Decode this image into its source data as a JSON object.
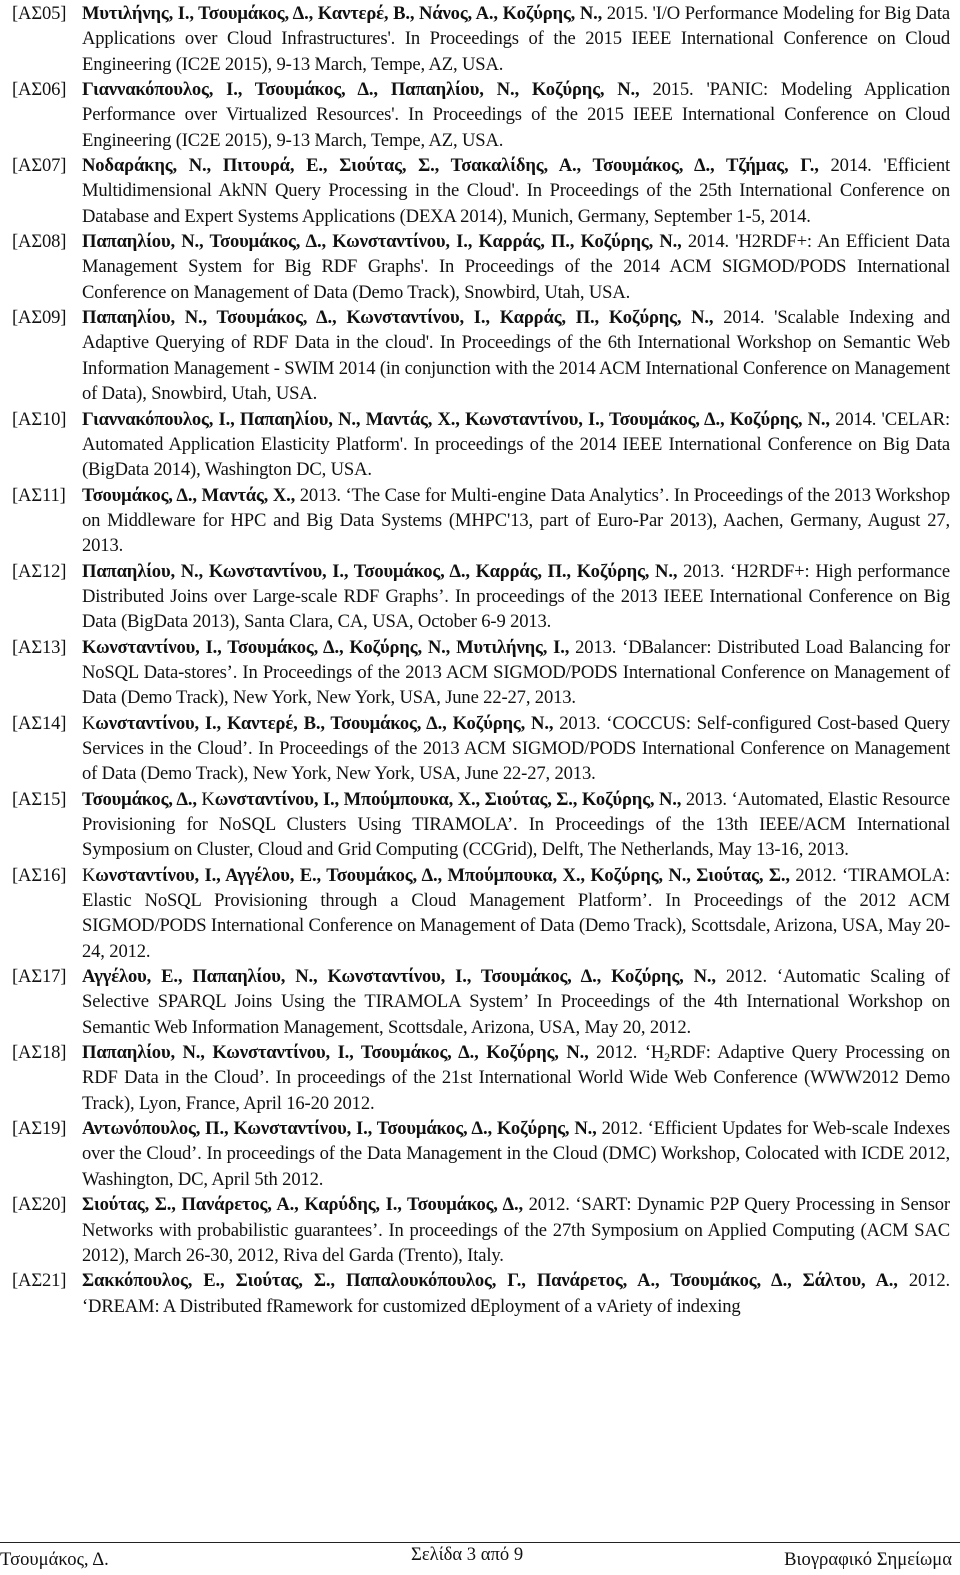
{
  "document": {
    "references": [
      {
        "id": "[ΑΣ05]",
        "authors": [
          {
            "text": "Μυτιλήνης, Ι., "
          },
          {
            "text": "Τσουμάκος, Δ., "
          },
          {
            "text": "Καντερέ, Β., "
          },
          {
            "text": "Νάνος, Α., "
          },
          {
            "text": "Κοζύρης, Ν.,"
          }
        ],
        "year": " 2015.",
        "body": " 'I/O Performance Modeling for Big Data Applications over Cloud Infrastructures'. In Proceedings of the 2015 IEEE International Conference on Cloud Engineering (IC2E 2015), 9-13 March, Tempe, AZ, USA."
      },
      {
        "id": "[ΑΣ06]",
        "authors": [
          {
            "text": "Γιαννακόπουλος, Ι., "
          },
          {
            "text": "Τσουμάκος, Δ., "
          },
          {
            "text": "Παπαηλίου, Ν., "
          },
          {
            "text": "Κοζύρης, Ν.,"
          }
        ],
        "year": " 2015.",
        "body": " 'PANIC: Modeling Application Performance over Virtualized Resources'. In Proceedings of the 2015 IEEE International Conference on Cloud Engineering (IC2E 2015), 9-13 March, Tempe, AZ, USA."
      },
      {
        "id": "[ΑΣ07]",
        "authors": [
          {
            "text": "Νοδαράκης, Ν., "
          },
          {
            "text": "Πιτουρά, Ε., "
          },
          {
            "text": "Σιούτας, Σ., "
          },
          {
            "text": "Τσακαλίδης, Α., "
          },
          {
            "text": "Τσουμάκος, Δ., "
          },
          {
            "text": "Τζήμας, Γ.,"
          }
        ],
        "year": " 2014.",
        "body": " 'Efficient Multidimensional AkNN Query Processing in the Cloud'. In Proceedings of the 25th International Conference on Database and Expert Systems Applications (DEXA 2014), Munich, Germany, September 1-5, 2014."
      },
      {
        "id": "[ΑΣ08]",
        "authors": [
          {
            "text": "Παπαηλίου, Ν., "
          },
          {
            "text": "Τσουμάκος, Δ., "
          },
          {
            "text": "Κωνσταντίνου, Ι., "
          },
          {
            "text": "Καρράς, Π., "
          },
          {
            "text": "Κοζύρης, Ν.,"
          }
        ],
        "year": " 2014.",
        "body": " 'H2RDF+: An Efficient Data Management System for Big RDF Graphs'. In Proceedings of the 2014 ACM SIGMOD/PODS International Conference on Management of Data (Demo Track), Snowbird, Utah, USA."
      },
      {
        "id": "[ΑΣ09]",
        "authors": [
          {
            "text": "Παπαηλίου, Ν., "
          },
          {
            "text": "Τσουμάκος, Δ., "
          },
          {
            "text": "Κωνσταντίνου, Ι., "
          },
          {
            "text": "Καρράς, Π., "
          },
          {
            "text": "Κοζύρης, Ν.,"
          }
        ],
        "year": " 2014.",
        "body": " 'Scalable Indexing and Adaptive Querying of RDF Data in the cloud'. In Proceedings of the 6th International Workshop on Semantic Web Information Management - SWIM 2014 (in conjunction with the 2014 ACM International Conference on Management of Data), Snowbird, Utah, USA."
      },
      {
        "id": "[ΑΣ10]",
        "authors": [
          {
            "text": "Γιαννακόπουλος, Ι., "
          },
          {
            "text": "Παπαηλίου, Ν., "
          },
          {
            "text": "Μαντάς, Χ., "
          },
          {
            "text": "Κωνσταντίνου, Ι., "
          },
          {
            "text": "Τσουμάκος, Δ., "
          },
          {
            "text": "Κοζύρης, Ν.,"
          }
        ],
        "year": " 2014.",
        "body": " 'CELAR: Automated Application Elasticity Platform'. In proceedings of the 2014 IEEE International Conference on Big Data (BigData 2014), Washington DC, USA."
      },
      {
        "id": "[ΑΣ11]",
        "authors": [
          {
            "text": "Τσουμάκος, Δ., "
          },
          {
            "text": "Μαντάς, Χ.,"
          }
        ],
        "year": " 2013.",
        "body": " ‘The Case for Multi-engine Data Analytics’. In Proceedings of the 2013 Workshop on Middleware for HPC and Big Data Systems (MHPC'13, part of Euro-Par 2013), Aachen, Germany, August 27, 2013."
      },
      {
        "id": "[ΑΣ12]",
        "authors": [
          {
            "text": "Παπαηλίου, Ν., "
          },
          {
            "text": "Κωνσταντίνου, Ι., "
          },
          {
            "text": "Τσουμάκος, Δ., "
          },
          {
            "text": "Καρράς, Π., "
          },
          {
            "text": "Κοζύρης, Ν.,"
          }
        ],
        "year": " 2013.",
        "body": " ‘H2RDF+: High performance Distributed Joins over Large-scale RDF Graphs’. In proceedings of the 2013 IEEE International Conference on Big Data (BigData 2013), Santa Clara, CA, USA, October 6-9 2013."
      },
      {
        "id": "[ΑΣ13]",
        "authors": [
          {
            "text": "Κωνσταντίνου, Ι., "
          },
          {
            "text": "Τσουμάκος, Δ., "
          },
          {
            "text": " Κοζύρης, Ν., "
          },
          {
            "text": "Μυτιλήνης, Ι.,"
          }
        ],
        "year": " 2013.",
        "body": " ‘DBalancer: Distributed Load Balancing for NoSQL Data-stores’. In Proceedings of the 2013 ACM SIGMOD/PODS International Conference on Management of Data (Demo Track), New York, New York, USA, June 22-27, 2013."
      },
      {
        "id": "[ΑΣ14]",
        "authors": [
          {
            "text": "Κωνσταντίνου, Ι., ",
            "light_initial": true
          },
          {
            "text": "Καντερέ, Β., "
          },
          {
            "text": "Τσουμάκος, Δ., "
          },
          {
            "text": " Κοζύρης, Ν.,"
          }
        ],
        "year": " 2013.",
        "body": " ‘COCCUS: Self-configured Cost-based Query Services in the Cloud’. In Proceedings of the 2013 ACM SIGMOD/PODS International Conference on Management of Data (Demo Track), New York, New York, USA, June 22-27, 2013."
      },
      {
        "id": "[ΑΣ15]",
        "authors": [
          {
            "text": "Τσουμάκος, Δ., "
          },
          {
            "text": "Κωνσταντίνου, Ι., ",
            "light_initial": true
          },
          {
            "text": "Μπούμπουκα, Χ., "
          },
          {
            "text": "Σιούτας, Σ., "
          },
          {
            "text": "Κοζύρης, Ν.,"
          }
        ],
        "year": " 2013.",
        "body": " ‘Automated, Elastic Resource Provisioning for NoSQL Clusters Using TIRAMOLA’. In Proceedings of the 13th IEEE/ACM International Symposium on Cluster, Cloud and Grid Computing (CCGrid), Delft, The Netherlands, May 13-16, 2013."
      },
      {
        "id": "[ΑΣ16]",
        "authors": [
          {
            "text": "Κωνσταντίνου, Ι., ",
            "light_initial": true
          },
          {
            "text": "Αγγέλου, Ε., "
          },
          {
            "text": "Τσουμάκος, Δ., "
          },
          {
            "text": "Μπούμπουκα, Χ., "
          },
          {
            "text": "Κοζύρης, Ν., "
          },
          {
            "text": "Σιούτας, Σ.,"
          }
        ],
        "year": " 2012.",
        "body": " ‘TIRAMOLA: Elastic NoSQL Provisioning through a Cloud Management Platform’. In Proceedings of the 2012 ACM SIGMOD/PODS International Conference on Management of Data (Demo Track), Scottsdale, Arizona, USA, May 20-24, 2012."
      },
      {
        "id": "[ΑΣ17]",
        "authors": [
          {
            "text": "Αγγέλου, Ε., "
          },
          {
            "text": "Παπαηλίου, Ν., "
          },
          {
            "text": "Κωνσταντίνου, Ι., "
          },
          {
            "text": "Τσουμάκος, Δ., "
          },
          {
            "text": "Κοζύρης, Ν.,"
          }
        ],
        "year": " 2012.",
        "body": " ‘Automatic Scaling of Selective SPARQL Joins Using the TIRAMOLA System’ In Proceedings of the 4th International Workshop on Semantic Web Information Management, Scottsdale, Arizona, USA, May 20, 2012."
      },
      {
        "id": "[ΑΣ18]",
        "authors": [
          {
            "text": "Παπαηλίου, Ν., "
          },
          {
            "text": "Κωνσταντίνου, Ι., "
          },
          {
            "text": "Τσουμάκος, Δ., "
          },
          {
            "text": "Κοζύρης, Ν.,"
          }
        ],
        "year": " 2012.",
        "body_pre": " ‘H",
        "body_sub": "2",
        "body": "RDF: Adaptive Query Processing on RDF Data in the Cloud’. In proceedings of the 21st International World Wide Web Conference (WWW2012 Demo Track), Lyon, France, April 16-20 2012."
      },
      {
        "id": "[ΑΣ19]",
        "authors": [
          {
            "text": "Αντωνόπουλος, Π., "
          },
          {
            "text": "Κωνσταντίνου, Ι., "
          },
          {
            "text": "Τσουμάκος, Δ., "
          },
          {
            "text": "Κοζύρης, Ν.,"
          }
        ],
        "year": " 2012.",
        "body": " ‘Efficient Updates for Web-scale Indexes over the Cloud’. In proceedings of the Data Management in the Cloud (DMC) Workshop, Colocated with ICDE 2012, Washington, DC, April 5th 2012."
      },
      {
        "id": "[ΑΣ20]",
        "authors": [
          {
            "text": "Σιούτας, Σ., "
          },
          {
            "text": "Πανάρετος, Α., "
          },
          {
            "text": "Καρύδης, Ι., "
          },
          {
            "text": "Τσουμάκος, Δ.,"
          }
        ],
        "year": " 2012.",
        "body": " ‘SART: Dynamic P2P Query Processing in Sensor Networks with probabilistic guarantees’. In proceedings of the 27th Symposium on Applied Computing (ACM SAC 2012), March 26-30, 2012, Riva del Garda (Trento), Italy."
      },
      {
        "id": "[ΑΣ21]",
        "authors": [
          {
            "text": "Σακκόπουλος, Ε., "
          },
          {
            "text": "Σιούτας, Σ., "
          },
          {
            "text": "Παπαλουκόπουλος, Γ., "
          },
          {
            "text": "Πανάρετος, Α., "
          },
          {
            "text": "Τσουμάκος, Δ., "
          },
          {
            "text": "Σάλτου, Α.,"
          }
        ],
        "year": " 2012.",
        "body": " ‘DREAM: A Distributed fRamework for customized dEployment of a vAriety of indexing"
      }
    ]
  },
  "footer": {
    "author": "Τσουμάκος, Δ.",
    "page_label": "Σελίδα  3 από 9",
    "doc_title": "Βιογραφικό Σημείωμα"
  }
}
